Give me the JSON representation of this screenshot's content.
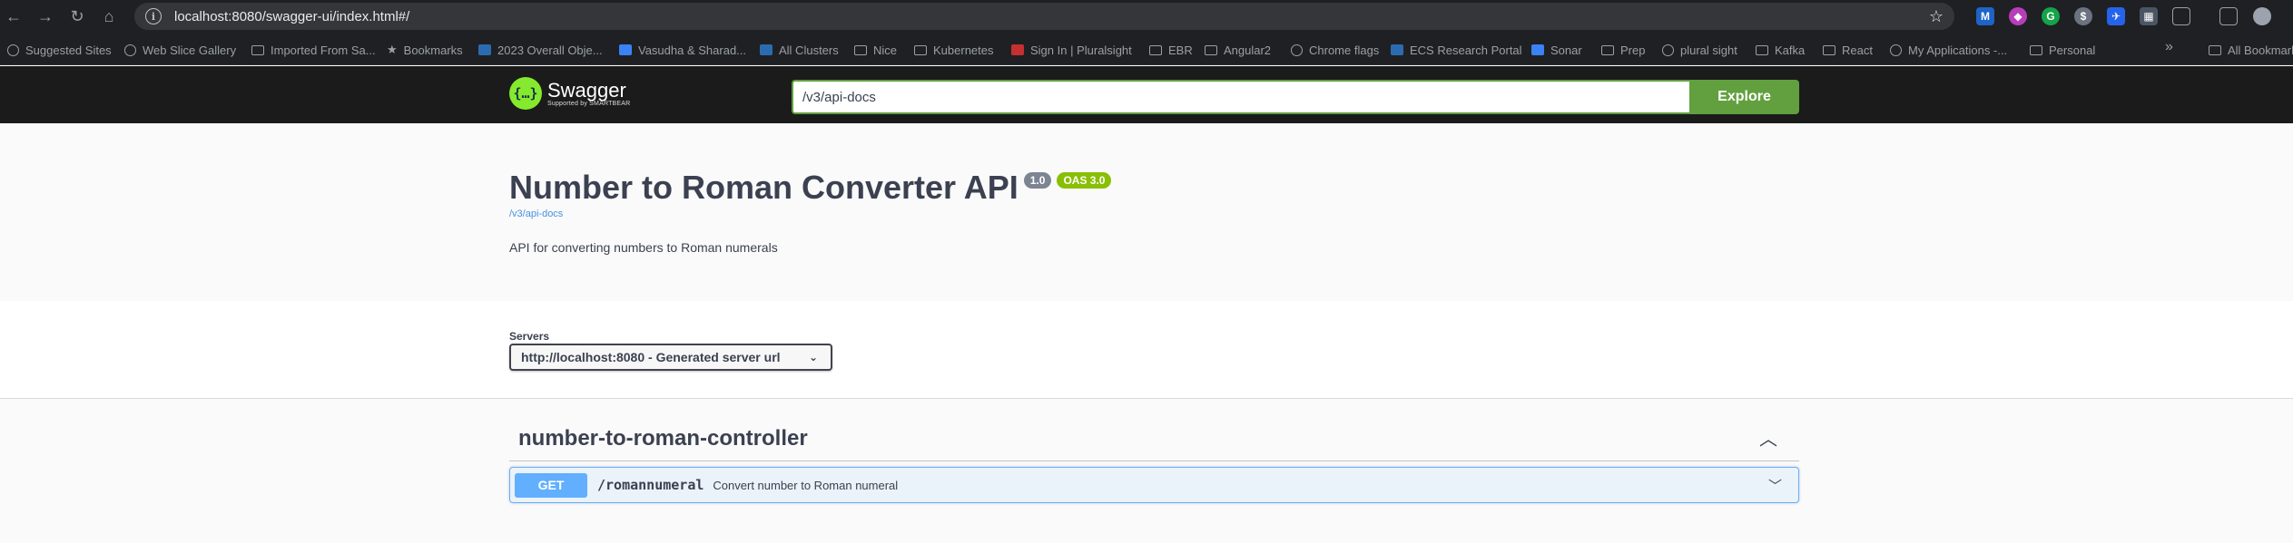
{
  "browser": {
    "url": "localhost:8080/swagger-ui/index.html#/",
    "bookmarks": [
      {
        "label": "Suggested Sites",
        "icon": "globe"
      },
      {
        "label": "Web Slice Gallery",
        "icon": "globe"
      },
      {
        "label": "Imported From Sa...",
        "icon": "folder"
      },
      {
        "label": "Bookmarks",
        "icon": "star"
      },
      {
        "label": "2023 Overall Obje...",
        "icon": "sq"
      },
      {
        "label": "Vasudha & Sharad...",
        "icon": "blue"
      },
      {
        "label": "All Clusters",
        "icon": "sq"
      },
      {
        "label": "Nice",
        "icon": "folder"
      },
      {
        "label": "Kubernetes",
        "icon": "folder"
      },
      {
        "label": "Sign In | Pluralsight",
        "icon": "red"
      },
      {
        "label": "EBR",
        "icon": "folder"
      },
      {
        "label": "Angular2",
        "icon": "folder"
      },
      {
        "label": "Chrome flags",
        "icon": "globe"
      },
      {
        "label": "ECS Research Portal",
        "icon": "sq"
      },
      {
        "label": "Sonar",
        "icon": "blue"
      },
      {
        "label": "Prep",
        "icon": "folder"
      },
      {
        "label": "plural sight",
        "icon": "globe"
      },
      {
        "label": "Kafka",
        "icon": "folder"
      },
      {
        "label": "React",
        "icon": "folder"
      },
      {
        "label": "My Applications -...",
        "icon": "globe"
      },
      {
        "label": "Personal",
        "icon": "folder"
      }
    ],
    "more": "»",
    "all_bookmarks": "All Bookmarks"
  },
  "topbar": {
    "logo_name": "Swagger",
    "logo_sub": "Supported by SMARTBEAR",
    "search_value": "/v3/api-docs",
    "explore_label": "Explore"
  },
  "info": {
    "title": "Number to Roman Converter API",
    "version": "1.0",
    "oas": "OAS 3.0",
    "spec_url": "/v3/api-docs",
    "description": "API for converting numbers to Roman numerals"
  },
  "servers": {
    "label": "Servers",
    "selected": "http://localhost:8080 - Generated server url"
  },
  "tag": {
    "name": "number-to-roman-controller"
  },
  "operation": {
    "method": "GET",
    "path": "/romannumeral",
    "summary": "Convert number to Roman numeral"
  }
}
